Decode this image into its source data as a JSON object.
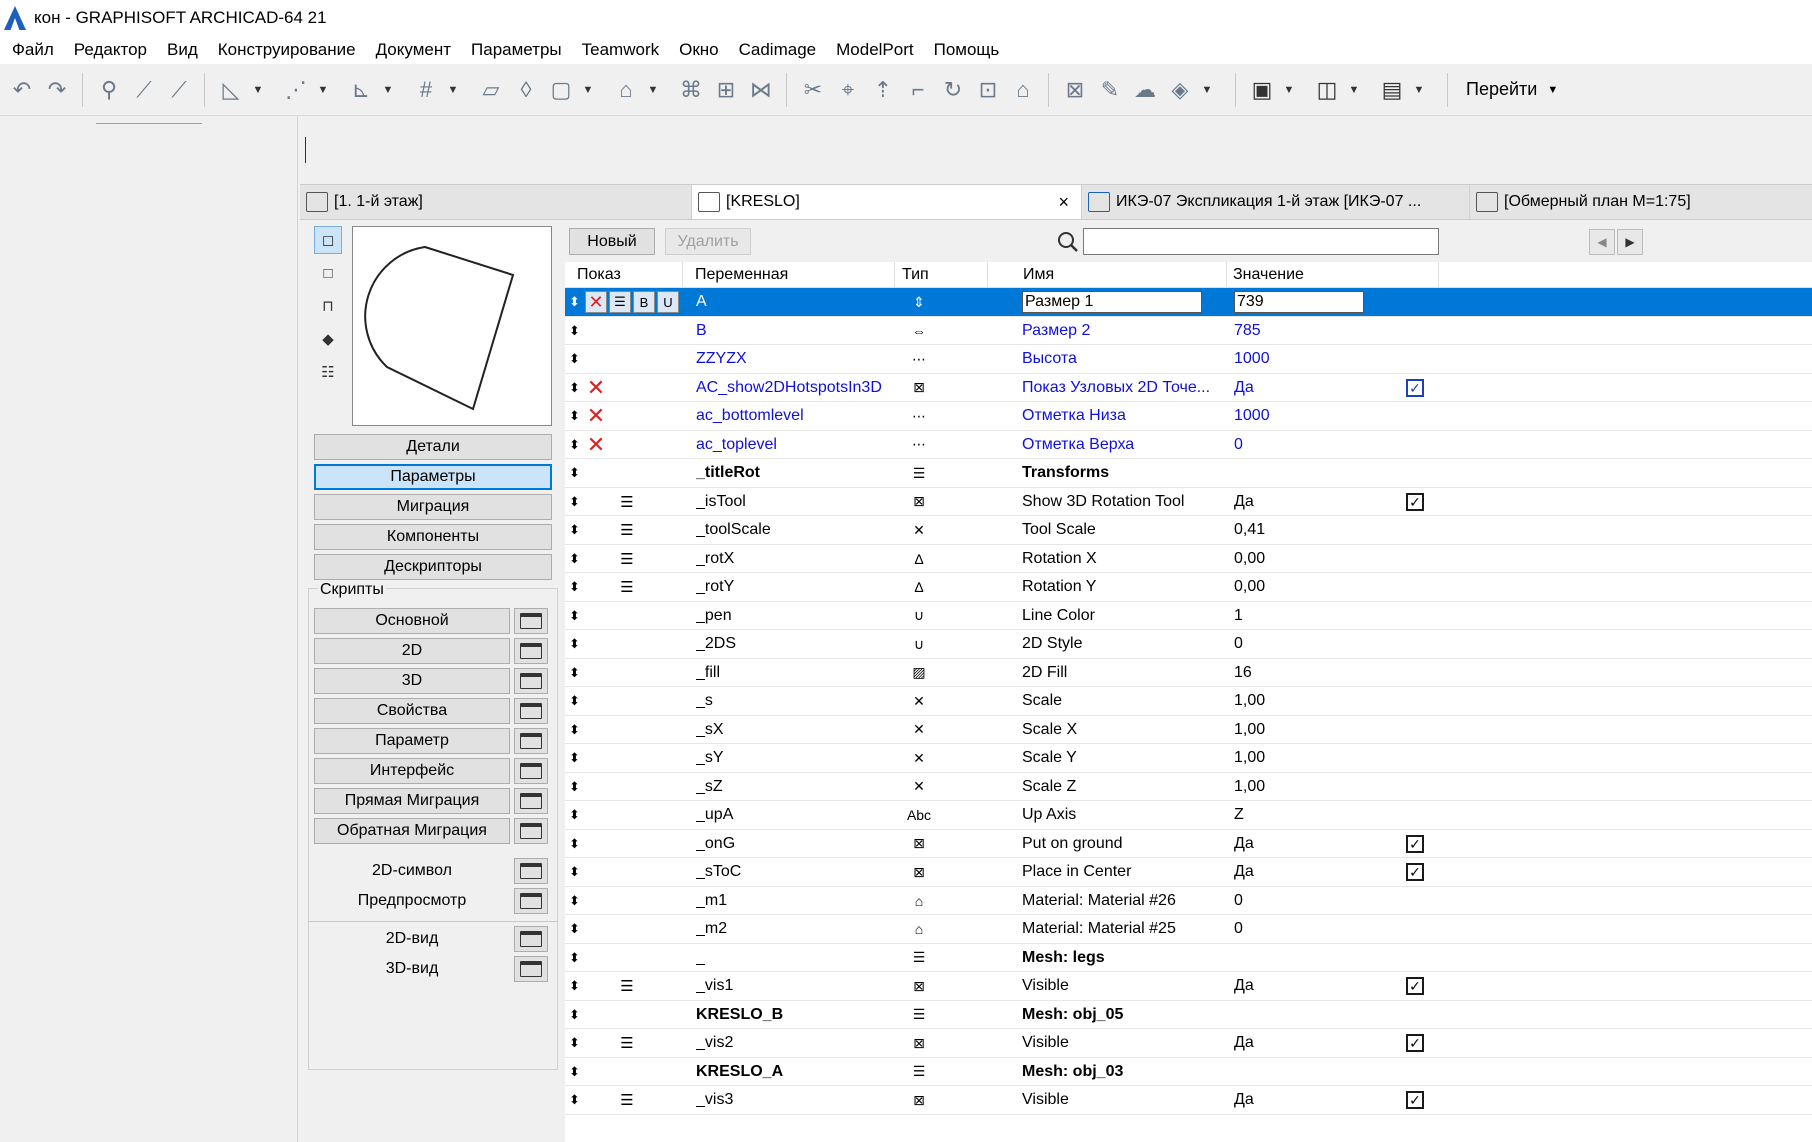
{
  "app": {
    "title": "кон - GRAPHISOFT ARCHICAD-64 21"
  },
  "menu": [
    "Файл",
    "Редактор",
    "Вид",
    "Конструирование",
    "Документ",
    "Параметры",
    "Teamwork",
    "Окно",
    "Cadimage",
    "ModelPort",
    "Помощь"
  ],
  "toolbar": {
    "goto_label": "Перейти"
  },
  "tabs": [
    {
      "label": "[1. 1-й этаж]"
    },
    {
      "label": "[KRESLO]",
      "close": "×"
    },
    {
      "label": "ИКЭ-07 Экспликация 1-й этаж [ИКЭ-07 ..."
    },
    {
      "label": "[Обмерный план M=1:75]"
    }
  ],
  "sidebar": {
    "nav": [
      "Детали",
      "Параметры",
      "Миграция",
      "Компоненты",
      "Дескрипторы"
    ],
    "selected_nav": "Параметры",
    "scripts_label": "Скрипты",
    "scripts": [
      "Основной",
      "2D",
      "3D",
      "Свойства",
      "Параметр",
      "Интерфейс",
      "Прямая Миграция",
      "Обратная Миграция"
    ],
    "extras": [
      "2D-символ",
      "Предпросмотр",
      "2D-вид",
      "3D-вид"
    ]
  },
  "params": {
    "new_label": "Новый",
    "delete_label": "Удалить",
    "search_placeholder": "",
    "headers": {
      "show": "Показ",
      "variable": "Переменная",
      "type": "Тип",
      "name": "Имя",
      "value": "Значение"
    },
    "selected_flags": {
      "b": "B",
      "u": "U"
    },
    "rows": [
      {
        "var": "A",
        "name": "Размер 1",
        "value": "739",
        "type_icon": "length-y-icon",
        "type_glyph": "⇕",
        "style": "selected",
        "flag": "",
        "list": "",
        "check": ""
      },
      {
        "var": "B",
        "name": "Размер 2",
        "value": "785",
        "type_icon": "length-x-icon",
        "type_glyph": "⇔",
        "style": "blue",
        "flag": "",
        "list": "",
        "check": ""
      },
      {
        "var": "ZZYZX",
        "name": "Высота",
        "value": "1000",
        "type_icon": "length-z-icon",
        "type_glyph": "⋯",
        "style": "blue",
        "flag": "",
        "list": "",
        "check": ""
      },
      {
        "var": "AC_show2DHotspotsIn3D",
        "name": "Показ Узловых 2D Точе...",
        "value": "Да",
        "type_icon": "boolean-icon",
        "type_glyph": "⊠",
        "style": "blue",
        "flag": "✕",
        "list": "",
        "check": "checked-blue"
      },
      {
        "var": "ac_bottomlevel",
        "name": "Отметка Низа",
        "value": "1000",
        "type_icon": "length-z-icon",
        "type_glyph": "⋯",
        "style": "blue",
        "flag": "✕",
        "list": "",
        "check": ""
      },
      {
        "var": "ac_toplevel",
        "name": "Отметка Верха",
        "value": "0",
        "type_icon": "length-z-icon",
        "type_glyph": "⋯",
        "style": "blue",
        "flag": "✕",
        "list": "",
        "check": ""
      },
      {
        "var": "_titleRot",
        "name": "Transforms",
        "value": "",
        "type_icon": "title-icon",
        "type_glyph": "☰",
        "style": "bold",
        "flag": "",
        "list": "",
        "check": ""
      },
      {
        "var": "_isTool",
        "name": "Show 3D Rotation Tool",
        "value": "Да",
        "type_icon": "boolean-icon",
        "type_glyph": "⊠",
        "style": "",
        "flag": "",
        "list": "☰",
        "check": "checked"
      },
      {
        "var": "_toolScale",
        "name": "Tool Scale",
        "value": "0,41",
        "type_icon": "real-number-icon",
        "type_glyph": "✕",
        "style": "",
        "flag": "",
        "list": "☰",
        "check": ""
      },
      {
        "var": "_rotX",
        "name": "Rotation X",
        "value": "0,00",
        "type_icon": "angle-icon",
        "type_glyph": "∆",
        "style": "",
        "flag": "",
        "list": "☰",
        "check": ""
      },
      {
        "var": "_rotY",
        "name": "Rotation Y",
        "value": "0,00",
        "type_icon": "angle-icon",
        "type_glyph": "∆",
        "style": "",
        "flag": "",
        "list": "☰",
        "check": ""
      },
      {
        "var": "_pen",
        "name": "Line Color",
        "value": "1",
        "type_icon": "pen-icon",
        "type_glyph": "∪",
        "style": "",
        "flag": "",
        "list": "",
        "check": ""
      },
      {
        "var": "_2DS",
        "name": "2D Style",
        "value": "0",
        "type_icon": "pen-icon",
        "type_glyph": "∪",
        "style": "",
        "flag": "",
        "list": "",
        "check": ""
      },
      {
        "var": "_fill",
        "name": "2D Fill",
        "value": "16",
        "type_icon": "fill-icon",
        "type_glyph": "▨",
        "style": "",
        "flag": "",
        "list": "",
        "check": ""
      },
      {
        "var": "_s",
        "name": "Scale",
        "value": "1,00",
        "type_icon": "real-number-icon",
        "type_glyph": "✕",
        "style": "",
        "flag": "",
        "list": "",
        "check": ""
      },
      {
        "var": "_sX",
        "name": "Scale X",
        "value": "1,00",
        "type_icon": "real-number-icon",
        "type_glyph": "✕",
        "style": "",
        "flag": "",
        "list": "",
        "check": ""
      },
      {
        "var": "_sY",
        "name": "Scale Y",
        "value": "1,00",
        "type_icon": "real-number-icon",
        "type_glyph": "✕",
        "style": "",
        "flag": "",
        "list": "",
        "check": ""
      },
      {
        "var": "_sZ",
        "name": "Scale Z",
        "value": "1,00",
        "type_icon": "real-number-icon",
        "type_glyph": "✕",
        "style": "",
        "flag": "",
        "list": "",
        "check": ""
      },
      {
        "var": "_upA",
        "name": "Up Axis",
        "value": "Z",
        "type_icon": "text-icon",
        "type_glyph": "Abc",
        "style": "",
        "flag": "",
        "list": "",
        "check": ""
      },
      {
        "var": "_onG",
        "name": "Put on ground",
        "value": "Да",
        "type_icon": "boolean-icon",
        "type_glyph": "⊠",
        "style": "",
        "flag": "",
        "list": "",
        "check": "checked"
      },
      {
        "var": "_sToC",
        "name": "Place in Center",
        "value": "Да",
        "type_icon": "boolean-icon",
        "type_glyph": "⊠",
        "style": "",
        "flag": "",
        "list": "",
        "check": "checked"
      },
      {
        "var": "_m1",
        "name": "Material: Material #26",
        "value": "0",
        "type_icon": "material-icon",
        "type_glyph": "⌂",
        "style": "",
        "flag": "",
        "list": "",
        "check": ""
      },
      {
        "var": "_m2",
        "name": "Material: Material #25",
        "value": "0",
        "type_icon": "material-icon",
        "type_glyph": "⌂",
        "style": "",
        "flag": "",
        "list": "",
        "check": ""
      },
      {
        "var": "_",
        "name": "Mesh: legs",
        "value": "",
        "type_icon": "title-icon",
        "type_glyph": "☰",
        "style": "bold-name",
        "flag": "",
        "list": "",
        "check": ""
      },
      {
        "var": "_vis1",
        "name": "Visible",
        "value": "Да",
        "type_icon": "boolean-icon",
        "type_glyph": "⊠",
        "style": "",
        "flag": "",
        "list": "☰",
        "check": "checked"
      },
      {
        "var": "KRESLO_B",
        "name": "Mesh: obj_05",
        "value": "",
        "type_icon": "title-icon",
        "type_glyph": "☰",
        "style": "bold",
        "flag": "",
        "list": "",
        "check": ""
      },
      {
        "var": "_vis2",
        "name": "Visible",
        "value": "Да",
        "type_icon": "boolean-icon",
        "type_glyph": "⊠",
        "style": "",
        "flag": "",
        "list": "☰",
        "check": "checked"
      },
      {
        "var": "KRESLO_A",
        "name": "Mesh: obj_03",
        "value": "",
        "type_icon": "title-icon",
        "type_glyph": "☰",
        "style": "bold",
        "flag": "",
        "list": "",
        "check": ""
      },
      {
        "var": "_vis3",
        "name": "Visible",
        "value": "Да",
        "type_icon": "boolean-icon",
        "type_glyph": "⊠",
        "style": "",
        "flag": "",
        "list": "☰",
        "check": "checked"
      }
    ]
  },
  "colors": {
    "selection": "#0078d7",
    "param_blue": "#1010dd",
    "flag_red": "#e02020"
  }
}
